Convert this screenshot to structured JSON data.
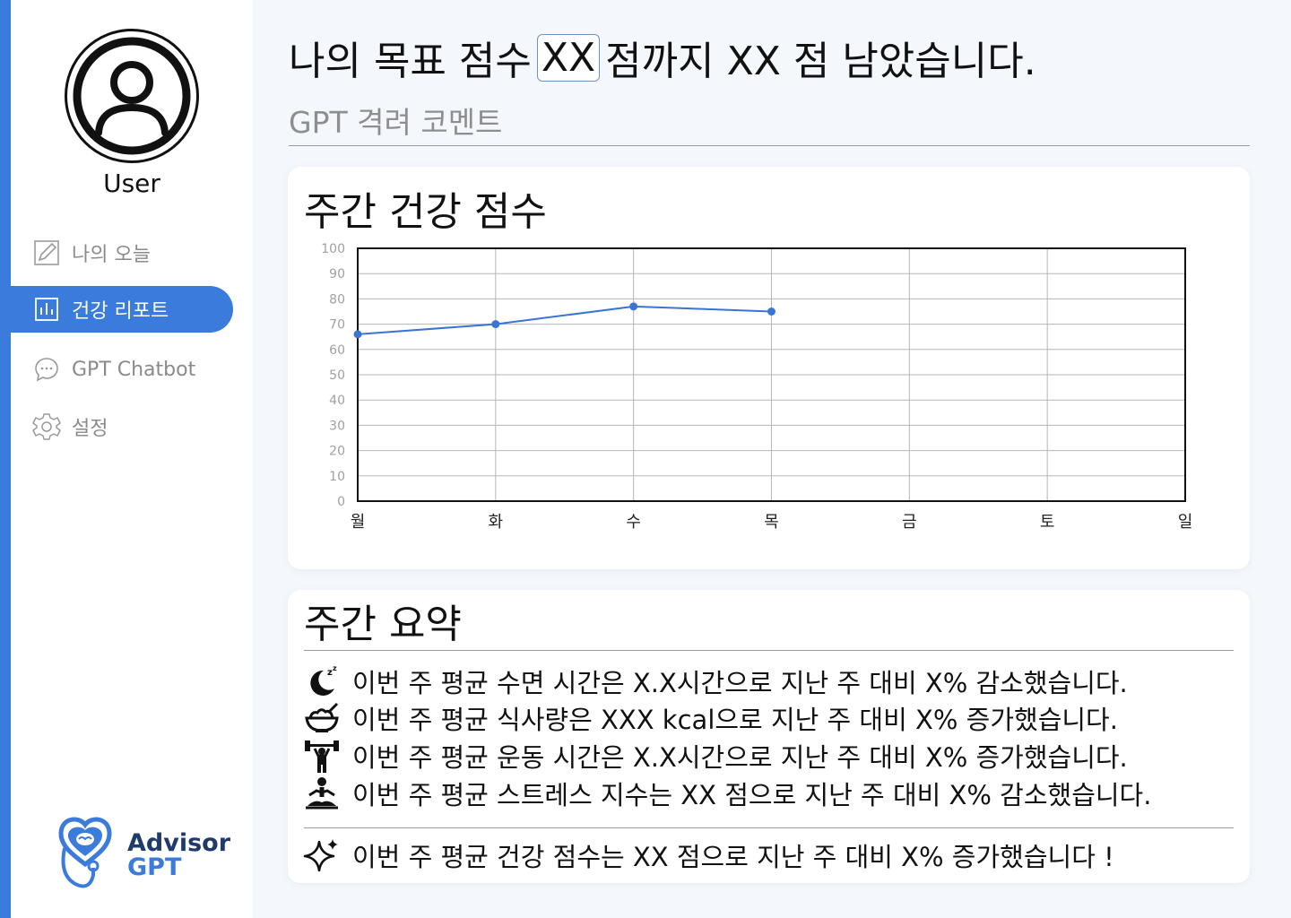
{
  "sidebar": {
    "user_name": "User",
    "nav": [
      {
        "label": "나의 오늘",
        "icon": "edit-icon"
      },
      {
        "label": "건강 리포트",
        "icon": "bar-chart-icon"
      },
      {
        "label": "GPT Chatbot",
        "icon": "chat-icon"
      },
      {
        "label": "설정",
        "icon": "gear-icon"
      }
    ],
    "active_index": 1,
    "logo": {
      "line1": "Advisor",
      "line2": "GPT",
      "icon": "stethoscope-brain-icon"
    }
  },
  "header": {
    "goal_prefix": "나의 목표 점수",
    "goal_value": "XX",
    "goal_suffix": "점까지 XX 점 남았습니다.",
    "comment": "GPT 격려 코멘트"
  },
  "weekly_chart": {
    "title": "주간 건강 점수"
  },
  "chart_data": {
    "type": "line",
    "categories": [
      "월",
      "화",
      "수",
      "목",
      "금",
      "토",
      "일"
    ],
    "series": [
      {
        "values": [
          66,
          70,
          77,
          75,
          null,
          null,
          null
        ]
      }
    ],
    "ylim": [
      0,
      100
    ],
    "yticks": [
      "0",
      "10",
      "20",
      "30",
      "40",
      "50",
      "60",
      "70",
      "80",
      "90",
      "100"
    ],
    "grid": true,
    "color": "#3a74d4"
  },
  "summary": {
    "title": "주간 요약",
    "items": [
      {
        "icon": "sleep-moon-icon",
        "text": "이번 주 평균 수면 시간은 X.X시간으로 지난 주 대비 X% 감소했습니다."
      },
      {
        "icon": "food-bowl-icon",
        "text": "이번 주 평균 식사량은 XXX kcal으로 지난 주 대비 X% 증가했습니다."
      },
      {
        "icon": "dumbbell-lift-icon",
        "text": "이번 주 평균 운동 시간은 X.X시간으로 지난 주 대비 X% 증가했습니다."
      },
      {
        "icon": "meditation-icon",
        "text": "이번 주 평균 스트레스 지수는 XX 점으로 지난 주 대비 X% 감소했습니다."
      }
    ],
    "total": {
      "icon": "sparkle-icon",
      "text": "이번 주 평균 건강 점수는 XX 점으로 지난 주 대비 X% 증가했습니다 !"
    }
  }
}
